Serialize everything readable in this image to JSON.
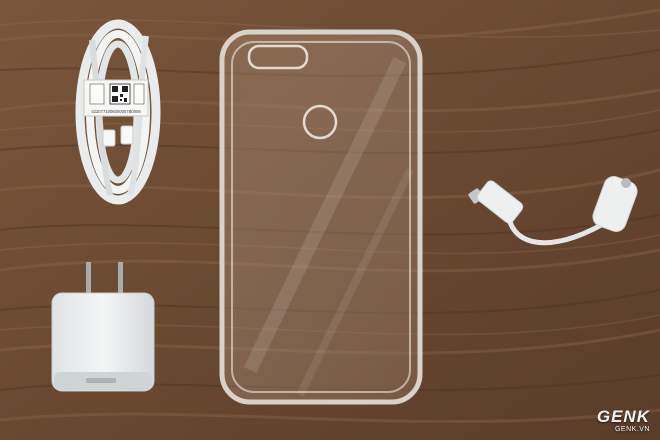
{
  "photo": {
    "subjects": [
      "coiled-usb-cable",
      "usb-power-adapter",
      "clear-phone-case",
      "usb-c-to-headphone-jack-adapter"
    ],
    "background": "wooden-table",
    "colors": {
      "wood_base": "#6b4a32",
      "wood_light": "#8a6446",
      "wood_dark": "#4e3322",
      "accessory_white": "#eef0f0",
      "case_edge": "#d9d2c9"
    }
  },
  "cable_label": {
    "serial": "4220771006000007B0006"
  },
  "watermark": {
    "logo": "GENK",
    "site": "GENK.VN"
  }
}
